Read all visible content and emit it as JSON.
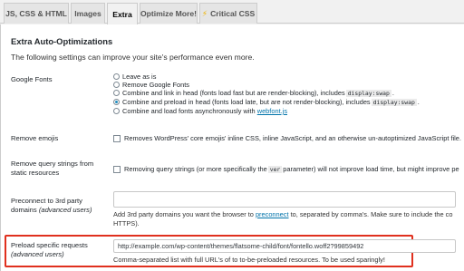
{
  "tabs": [
    {
      "label": "JS, CSS & HTML"
    },
    {
      "label": "Images"
    },
    {
      "label": "Extra"
    },
    {
      "label": "Optimize More!"
    },
    {
      "label": "Critical CSS"
    }
  ],
  "section": {
    "title": "Extra Auto-Optimizations",
    "intro": "The following settings can improve your site's performance even more."
  },
  "google_fonts": {
    "label": "Google Fonts",
    "options": [
      {
        "text": "Leave as is"
      },
      {
        "text": "Remove Google Fonts"
      },
      {
        "text_before": "Combine and link in head (fonts load fast but are render-blocking), includes",
        "code": "display:swap",
        "text_after": "."
      },
      {
        "text_before": "Combine and preload in head (fonts load late, but are not render-blocking), includes",
        "code": "display:swap",
        "text_after": "."
      },
      {
        "text_before": "Combine and load fonts asynchronously with",
        "link": "webfont.js"
      }
    ],
    "selected_index": 3
  },
  "remove_emojis": {
    "label": "Remove emojis",
    "text": "Removes WordPress' core emojis' inline CSS, inline JavaScript, and an otherwise un-autoptimized JavaScript file."
  },
  "remove_query": {
    "label_line1": "Remove query strings from",
    "label_line2": "static resources",
    "text_before": "Removing query strings (or more specifically the",
    "code": "ver",
    "text_after": "parameter) will not improve load time, but might improve pe"
  },
  "preconnect": {
    "label_line1": "Preconnect to 3rd party",
    "label_line2_a": "domains",
    "label_line2_b": "(advanced users)",
    "desc_before": "Add 3rd party domains you want the browser to",
    "desc_link": "preconnect",
    "desc_after": "to, separated by comma's. Make sure to include the co",
    "desc_line2": "HTTPS)."
  },
  "preload": {
    "label_line1": "Preload specific requests",
    "label_line2": "(advanced users)",
    "value": "http://example.com/wp-content/themes/flatsome-child/font/fontello.woff2?99859492",
    "desc": "Comma-separated list with full URL's of to to-be-preloaded resources. To be used sparingly!"
  }
}
